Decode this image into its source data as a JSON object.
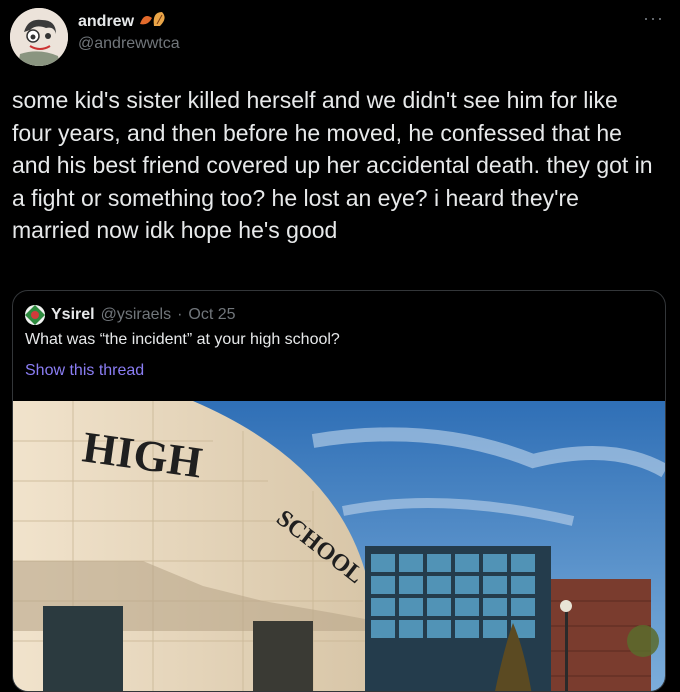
{
  "tweet": {
    "display_name": "andrew",
    "handle": "@andrewwtca",
    "emoji_icon": "leaves-icon",
    "more_icon": "more-icon",
    "text": "some kid's sister killed herself and we didn't see him for like four years, and then before he moved, he confessed that he and his best friend covered up her accidental death. they got in a fight or something too? he lost an eye? i heard they're married now idk hope he's good"
  },
  "quote": {
    "display_name": "Ysirel",
    "handle": "@ysiraels",
    "separator": "·",
    "date": "Oct 25",
    "text": "What was “the incident” at your high school?",
    "show_thread": "Show this thread",
    "image": {
      "sign_word_1": "HIGH",
      "sign_word_2": "SCHOOL"
    }
  },
  "colors": {
    "background": "#000000",
    "text": "#e7e9ea",
    "muted": "#71767b",
    "link": "#8a7df3",
    "border": "#333639"
  }
}
